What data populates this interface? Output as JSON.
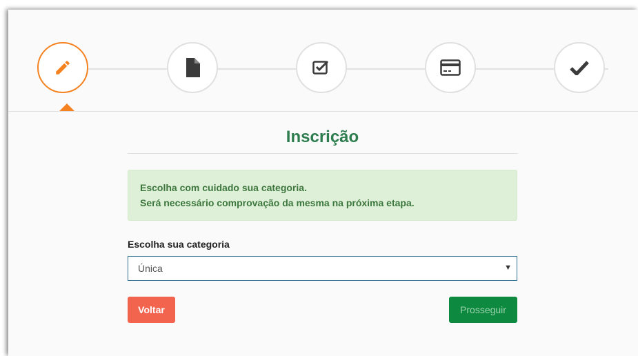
{
  "wizard": {
    "steps": [
      {
        "icon": "pencil-icon",
        "state": "active"
      },
      {
        "icon": "file-icon",
        "state": "pending"
      },
      {
        "icon": "checkbox-icon",
        "state": "pending"
      },
      {
        "icon": "credit-card-icon",
        "state": "pending"
      },
      {
        "icon": "checkmark-icon",
        "state": "pending"
      }
    ],
    "active_color": "#f58220"
  },
  "form": {
    "title": "Inscrição",
    "alert": {
      "line1": "Escolha com cuidado sua categoria.",
      "line2": "Será necessário comprovação da mesma na próxima etapa."
    },
    "category_label": "Escolha sua categoria",
    "category_value": "Única",
    "back_label": "Voltar",
    "next_label": "Prosseguir"
  },
  "colors": {
    "title": "#2e7d4f",
    "alert_bg": "#dff0d8",
    "back_button": "#f2644e",
    "next_button": "#0d8a3f"
  }
}
